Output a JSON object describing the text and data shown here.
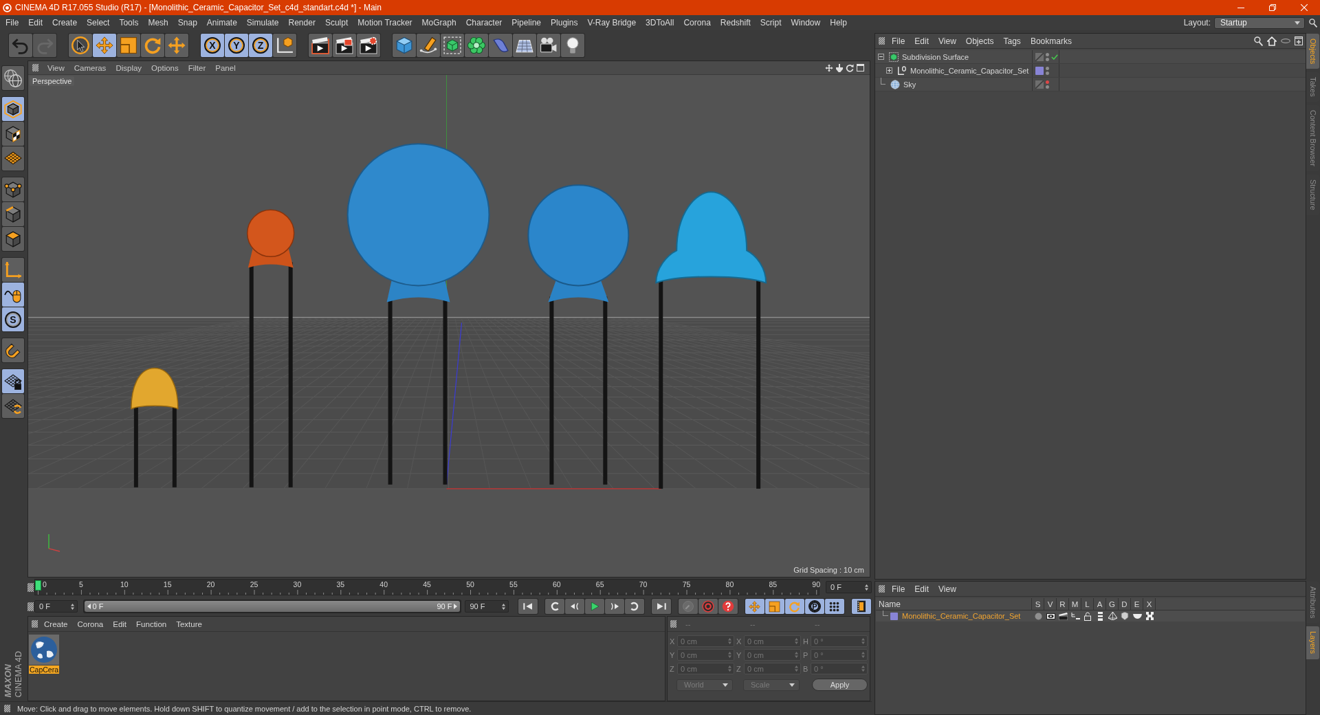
{
  "window": {
    "title": "CINEMA 4D R17.055 Studio (R17) - [Monolithic_Ceramic_Capacitor_Set_c4d_standart.c4d *] - Main"
  },
  "menu_bar": {
    "items": [
      "File",
      "Edit",
      "Create",
      "Select",
      "Tools",
      "Mesh",
      "Snap",
      "Animate",
      "Simulate",
      "Render",
      "Sculpt",
      "Motion Tracker",
      "MoGraph",
      "Character",
      "Pipeline",
      "Plugins",
      "V-Ray Bridge",
      "3DToAll",
      "Corona",
      "Redshift",
      "Script",
      "Window",
      "Help"
    ],
    "layout_label": "Layout:",
    "layout_value": "Startup"
  },
  "toolbar": [
    [
      {
        "kind": "undo",
        "active": false,
        "disabled": false
      },
      {
        "kind": "redo",
        "active": false,
        "disabled": true
      }
    ],
    [
      {
        "kind": "select",
        "active": false,
        "disabled": false
      },
      {
        "kind": "move",
        "active": true,
        "disabled": false
      },
      {
        "kind": "scale",
        "active": false,
        "disabled": false
      },
      {
        "kind": "rotate",
        "active": false,
        "disabled": false
      },
      {
        "kind": "transform",
        "active": false,
        "disabled": false
      }
    ],
    [
      {
        "kind": "axis",
        "label": "X",
        "active": true,
        "disabled": false
      },
      {
        "kind": "axis",
        "label": "Y",
        "active": true,
        "disabled": false
      },
      {
        "kind": "axis",
        "label": "Z",
        "active": true,
        "disabled": false
      },
      {
        "kind": "coordinates",
        "active": false,
        "disabled": false
      }
    ],
    [
      {
        "kind": "render_view",
        "active": false,
        "disabled": false
      },
      {
        "kind": "render_picture",
        "active": false,
        "disabled": false
      },
      {
        "kind": "render_settings",
        "active": false,
        "disabled": false
      }
    ],
    [
      {
        "kind": "cube",
        "active": false,
        "disabled": false
      },
      {
        "kind": "pen",
        "active": false,
        "disabled": false
      },
      {
        "kind": "subdivision",
        "active": false,
        "disabled": false
      },
      {
        "kind": "cloner",
        "active": false,
        "disabled": false
      },
      {
        "kind": "deformer",
        "active": false,
        "disabled": false
      },
      {
        "kind": "floor",
        "active": false,
        "disabled": false
      },
      {
        "kind": "camera",
        "active": false,
        "disabled": false
      },
      {
        "kind": "light",
        "active": false,
        "disabled": false
      }
    ]
  ],
  "left_toolbar": [
    [
      {
        "kind": "make_editable",
        "active": false
      }
    ],
    [
      {
        "kind": "model",
        "active": true
      },
      {
        "kind": "texture",
        "active": false
      },
      {
        "kind": "workplane",
        "active": false
      }
    ],
    [
      {
        "kind": "points",
        "active": false
      },
      {
        "kind": "edges",
        "active": false
      },
      {
        "kind": "polygons",
        "active": false
      }
    ],
    [
      {
        "kind": "axis_mode",
        "active": false
      },
      {
        "kind": "tweak",
        "active": true
      },
      {
        "kind": "solo",
        "label": "S",
        "active": true
      }
    ],
    [
      {
        "kind": "snap",
        "active": false
      }
    ],
    [
      {
        "kind": "workplane_lock",
        "active": true
      },
      {
        "kind": "planar",
        "active": false
      }
    ]
  ],
  "viewport": {
    "menu": [
      "View",
      "Cameras",
      "Display",
      "Options",
      "Filter",
      "Panel"
    ],
    "camera": "Perspective",
    "grid_spacing": "Grid Spacing : 10 cm"
  },
  "timeline": {
    "ticks": [
      "0",
      "5",
      "10",
      "15",
      "20",
      "25",
      "30",
      "35",
      "40",
      "45",
      "50",
      "55",
      "60",
      "65",
      "70",
      "75",
      "80",
      "85",
      "90"
    ],
    "playhead": {
      "level": 0
    },
    "current_frame": "0 F",
    "start_field": "0 F",
    "range": {
      "start": "0 F",
      "end": "90 F",
      "level": 1
    },
    "end_field": "90 F",
    "key_filters": [
      {
        "kind": "position",
        "active": true
      },
      {
        "kind": "scale",
        "active": true
      },
      {
        "kind": "rotation",
        "active": true
      },
      {
        "kind": "parameter",
        "label": "P",
        "active": true
      },
      {
        "kind": "points",
        "active": true
      }
    ],
    "timeline_button": {
      "active": true
    }
  },
  "material_manager": {
    "menu": [
      "Create",
      "Corona",
      "Edit",
      "Function",
      "Texture"
    ],
    "materials": [
      {
        "name": "CapCera",
        "selected": true
      }
    ]
  },
  "coordinates": {
    "disabled": true,
    "headers": [
      "--",
      "--",
      "--"
    ],
    "rows": [
      [
        {
          "label": "X",
          "value": "0 cm"
        },
        {
          "label": "X",
          "value": "0 cm"
        },
        {
          "label": "H",
          "value": "0 °"
        }
      ],
      [
        {
          "label": "Y",
          "value": "0 cm"
        },
        {
          "label": "Y",
          "value": "0 cm"
        },
        {
          "label": "P",
          "value": "0 °"
        }
      ],
      [
        {
          "label": "Z",
          "value": "0 cm"
        },
        {
          "label": "Z",
          "value": "0 cm"
        },
        {
          "label": "B",
          "value": "0 °"
        }
      ]
    ],
    "space": "World",
    "size_mode": "Scale",
    "apply": "Apply"
  },
  "logo": {
    "brand": "MAXON",
    "product": "CINEMA 4D"
  },
  "status_bar": {
    "text": "Move: Click and drag to move elements. Hold down SHIFT to quantize movement / add to the selection in point mode, CTRL to remove."
  },
  "object_manager": {
    "menu": [
      "File",
      "Edit",
      "View",
      "Objects",
      "Tags",
      "Bookmarks"
    ],
    "objects": [
      {
        "name": "Subdivision Surface",
        "kind": "subdivision",
        "expanded": true,
        "hidden_in_editor": false,
        "hidden_in_render": false,
        "enabled": true,
        "children": [
          {
            "name": "Monolithic_Ceramic_Capacitor_Set",
            "kind": "null",
            "expanded": false,
            "color": "#8884d6",
            "hidden_in_editor": false,
            "hidden_in_render": false
          }
        ]
      },
      {
        "name": "Sky",
        "kind": "sky",
        "hidden_in_editor": true,
        "hidden_in_render": false
      }
    ]
  },
  "side_tabs_top": [
    {
      "label": "Objects",
      "selected": true
    },
    {
      "label": "Takes",
      "selected": false
    },
    {
      "label": "Content Browser",
      "selected": false
    },
    {
      "label": "Structure",
      "selected": false
    }
  ],
  "layer_manager": {
    "menu": [
      "File",
      "Edit",
      "View"
    ],
    "columns": [
      "Name",
      "S",
      "V",
      "R",
      "M",
      "L",
      "A",
      "G",
      "D",
      "E",
      "X"
    ],
    "layers": [
      {
        "name": "Monolithic_Ceramic_Capacitor_Set",
        "color": "#8884d6"
      }
    ]
  },
  "side_tabs_bottom": [
    {
      "label": "Attributes",
      "selected": false
    },
    {
      "label": "Layers",
      "selected": true
    }
  ]
}
